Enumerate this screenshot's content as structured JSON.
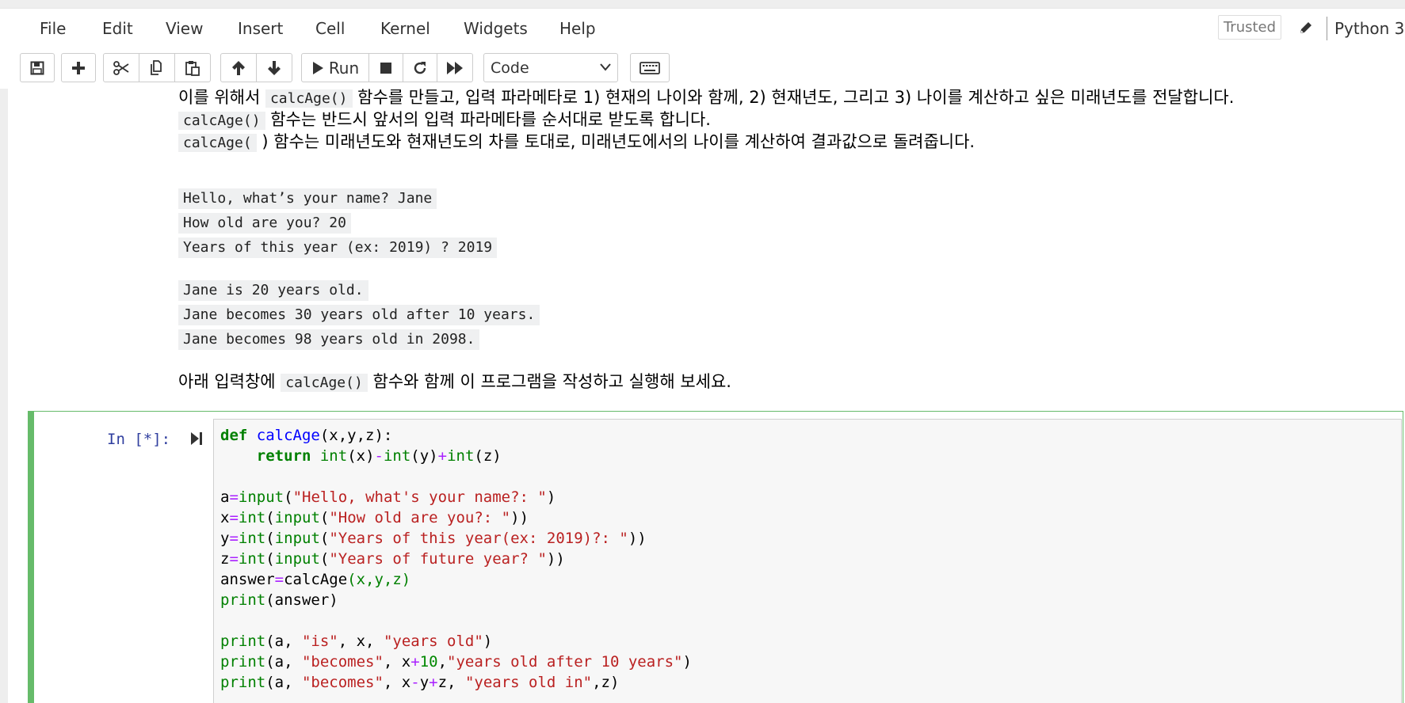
{
  "menu": [
    "File",
    "Edit",
    "View",
    "Insert",
    "Cell",
    "Kernel",
    "Widgets",
    "Help"
  ],
  "status": {
    "trusted": "Trusted",
    "kernel": "Python 3"
  },
  "toolbar": {
    "run_label": "Run",
    "cell_type": "Code"
  },
  "markdown": {
    "line1": {
      "pre": "이를 위해서 ",
      "code": "calcAge()",
      "post": " 함수를 만들고, 입력 파라메타로 1) 현재의 나이와 함께, 2) 현재년도, 그리고 3) 나이를 계산하고 싶은 미래년도를 전달합니다."
    },
    "line2": {
      "code": "calcAge()",
      "post": " 함수는 반드시 앞서의 입력 파라메타를 순서대로 받도록 합니다."
    },
    "line3": {
      "code": "calcAge(",
      "post": " ) 함수는 미래년도와 현재년도의 차를 토대로, 미래년도에서의 나이를 계산하여 결과값으로 돌려줍니다."
    },
    "example_input": [
      "Hello, what’s your name? Jane",
      "How old are you? 20",
      "Years of this year (ex: 2019) ? 2019"
    ],
    "example_output": [
      "Jane is 20 years old.",
      "Jane becomes 30 years old after 10 years.",
      "Jane becomes 98 years old in 2098."
    ],
    "instruction": {
      "pre": "아래 입력창에 ",
      "code": "calcAge()",
      "post": " 함수와 함께 이 프로그램을 작성하고 실행해 보세요."
    }
  },
  "cell": {
    "prompt": "In [*]:"
  },
  "code": {
    "l1": {
      "kw": "def",
      "fn": "calcAge",
      "rest": "(x,y,z):"
    },
    "l2": {
      "kw": "return",
      "b1": "int",
      "a1": "(x)",
      "op1": "-",
      "b2": "int",
      "a2": "(y)",
      "op2": "+",
      "b3": "int",
      "a3": "(z)"
    },
    "l3": {
      "v": "a",
      "op": "=",
      "b": "input",
      "p1": "(",
      "s": "\"Hello, what's your name?: \"",
      "p2": ")"
    },
    "l4": {
      "v": "x",
      "op": "=",
      "b1": "int",
      "p1": "(",
      "b2": "input",
      "p2": "(",
      "s": "\"How old are you?: \"",
      "p3": "))"
    },
    "l5": {
      "v": "y",
      "op": "=",
      "b1": "int",
      "p1": "(",
      "b2": "input",
      "p2": "(",
      "s": "\"Years of this year(ex: 2019)?: \"",
      "p3": "))"
    },
    "l6": {
      "v": "z",
      "op": "=",
      "b1": "int",
      "p1": "(",
      "b2": "input",
      "p2": "(",
      "s": "\"Years of future year? \"",
      "p3": "))"
    },
    "l7": {
      "v": "answer",
      "op": "=",
      "call": "calcAge",
      "args": "(x,y,z)"
    },
    "l8": {
      "b": "print",
      "args": "(answer)"
    },
    "l9": {
      "b": "print",
      "a": "(a, ",
      "s1": "\"is\"",
      "m": ", x, ",
      "s2": "\"years old\"",
      "e": ")"
    },
    "l10": {
      "b": "print",
      "a": "(a, ",
      "s1": "\"becomes\"",
      "m1": ", x",
      "op": "+",
      "n": "10",
      "m2": ",",
      "s2": "\"years old after 10 years\"",
      "e": ")"
    },
    "l11": {
      "b": "print",
      "a": "(a, ",
      "s1": "\"becomes\"",
      "m1": ", x",
      "op1": "-",
      "m2": "y",
      "op2": "+",
      "m3": "z, ",
      "s2": "\"years old in\"",
      "e": ",z)"
    }
  }
}
